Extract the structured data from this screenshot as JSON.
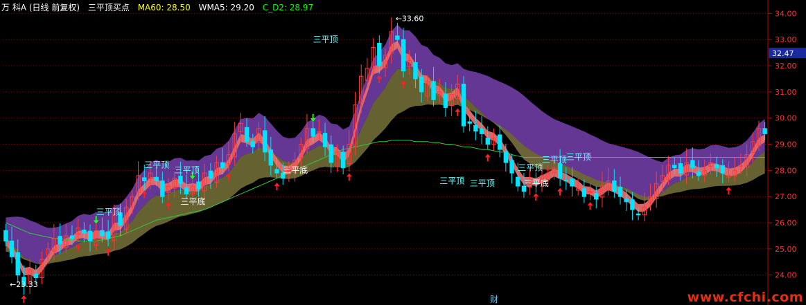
{
  "header": {
    "title": "万 科A (日线 前复权)",
    "indicator_name": "三平顶买点",
    "ma60": "MA60: 28.50",
    "wma5": "WMA5: 29.20",
    "cd2": "C_D2: 28.97"
  },
  "watermark": "www.cfchi.com",
  "colors": {
    "up": "#ff3b3b",
    "down": "#00e5ff",
    "ma60": "#2ecc40",
    "band_purple": "#6a3a9c",
    "band_olive": "#6b6633",
    "band_pink": "#e86a6a",
    "band_blue": "#2f8fe8",
    "grid": "#7a0000",
    "axis": "#c00000"
  },
  "chart_data": {
    "type": "candlestick",
    "ylim": [
      23.2,
      34.3
    ],
    "y_ticks": [
      "34.00",
      "33.00",
      "32.00",
      "31.00",
      "30.00",
      "29.00",
      "28.00",
      "27.00",
      "26.00",
      "25.00",
      "24.00"
    ],
    "current_price": "32.47",
    "bottom_marker": "财",
    "min_label": "←23.33",
    "max_label": "←33.60",
    "close": [
      25.3,
      24.7,
      24.0,
      23.6,
      24.2,
      23.9,
      24.6,
      25.0,
      25.4,
      25.2,
      25.5,
      25.4,
      25.8,
      25.6,
      25.3,
      25.7,
      25.5,
      25.4,
      26.3,
      25.9,
      26.6,
      27.0,
      27.8,
      27.6,
      27.9,
      27.6,
      27.0,
      27.4,
      27.7,
      27.5,
      27.1,
      27.4,
      27.3,
      27.9,
      27.7,
      28.3,
      28.1,
      28.6,
      29.4,
      29.8,
      29.1,
      28.9,
      29.6,
      28.7,
      28.2,
      27.9,
      27.7,
      28.0,
      28.4,
      29.0,
      29.6,
      29.3,
      29.5,
      28.9,
      28.3,
      28.7,
      28.1,
      29.0,
      30.5,
      31.6,
      31.9,
      32.7,
      32.0,
      32.4,
      33.3,
      33.0,
      31.8,
      32.2,
      31.5,
      31.0,
      31.4,
      30.7,
      31.0,
      30.4,
      30.9,
      31.3,
      29.7,
      29.8,
      29.5,
      29.4,
      29.0,
      29.2,
      28.8,
      28.3,
      27.9,
      27.4,
      27.2,
      27.6,
      27.5,
      27.8,
      27.9,
      28.1,
      27.7,
      27.6,
      27.4,
      27.3,
      27.0,
      27.2,
      26.9,
      27.4,
      27.6,
      27.2,
      27.0,
      26.8,
      26.5,
      26.3,
      26.6,
      27.0,
      27.5,
      27.8,
      28.2,
      28.1,
      27.9,
      28.3,
      28.1,
      27.8,
      28.0,
      28.3,
      28.1,
      27.9,
      27.8,
      28.0,
      28.2,
      28.6,
      29.1,
      29.6,
      29.4
    ],
    "ma60": [
      26.0,
      25.9,
      25.8,
      25.7,
      25.6,
      25.55,
      25.5,
      25.45,
      25.4,
      25.4,
      25.35,
      25.35,
      25.3,
      25.3,
      25.3,
      25.3,
      25.35,
      25.4,
      25.45,
      25.5,
      25.6,
      25.7,
      25.8,
      25.9,
      26.0,
      26.1,
      26.15,
      26.2,
      26.25,
      26.3,
      26.35,
      26.4,
      26.45,
      26.5,
      26.6,
      26.7,
      26.8,
      26.9,
      27.0,
      27.1,
      27.2,
      27.3,
      27.4,
      27.5,
      27.6,
      27.7,
      27.8,
      27.9,
      28.0,
      28.1,
      28.2,
      28.3,
      28.4,
      28.5,
      28.6,
      28.7,
      28.8,
      28.85,
      28.9,
      28.95,
      29.0,
      29.05,
      29.1,
      29.1,
      29.15,
      29.15,
      29.15,
      29.15,
      29.1,
      29.1,
      29.1,
      29.05,
      29.05,
      29.0,
      29.0,
      28.95,
      28.9,
      28.9,
      28.85,
      28.8,
      28.8,
      28.75,
      28.7,
      28.7,
      28.6,
      28.55,
      28.5,
      28.5,
      28.5,
      28.5,
      28.5,
      28.5,
      28.5,
      28.5,
      28.5,
      28.5,
      28.5,
      28.5,
      28.5,
      28.5,
      28.5,
      28.5,
      28.5,
      28.5,
      28.5,
      28.5,
      28.5,
      28.5,
      28.5,
      28.5,
      28.5,
      28.5,
      28.5,
      28.5,
      28.5,
      28.5,
      28.5,
      28.5,
      28.5,
      28.5,
      28.5,
      28.5,
      28.5,
      28.5,
      28.5,
      28.5,
      28.5
    ],
    "annotations": [
      {
        "text": "三平顶",
        "index": 23,
        "price": 28.1,
        "color": "#66ffff"
      },
      {
        "text": "三平顶",
        "index": 28,
        "price": 27.9,
        "color": "#66ffff"
      },
      {
        "text": "三平顶",
        "index": 15,
        "price": 26.3,
        "color": "#66ffff"
      },
      {
        "text": "三平底",
        "index": 29,
        "price": 26.7,
        "color": "#ffffff"
      },
      {
        "text": "三平底",
        "index": 46,
        "price": 27.9,
        "color": "#ffffff"
      },
      {
        "text": "三平顶",
        "index": 51,
        "price": 32.9,
        "color": "#66ffff"
      },
      {
        "text": "三平顶",
        "index": 72,
        "price": 27.5,
        "color": "#66ffff"
      },
      {
        "text": "三平顶",
        "index": 77,
        "price": 27.4,
        "color": "#66ffff"
      },
      {
        "text": "三平顶",
        "index": 85,
        "price": 28.0,
        "color": "#66ffff"
      },
      {
        "text": "三平顶",
        "index": 89,
        "price": 28.3,
        "color": "#66ffff"
      },
      {
        "text": "三平顶",
        "index": 93,
        "price": 28.4,
        "color": "#66ffff"
      },
      {
        "text": "三平底",
        "index": 86,
        "price": 27.4,
        "color": "#ffffff"
      }
    ],
    "up_arrows": [
      3,
      12,
      17,
      23,
      27,
      37,
      45,
      57,
      62,
      66,
      75,
      80,
      88,
      92,
      97,
      120
    ],
    "down_arrows": [
      15,
      31,
      51
    ]
  }
}
